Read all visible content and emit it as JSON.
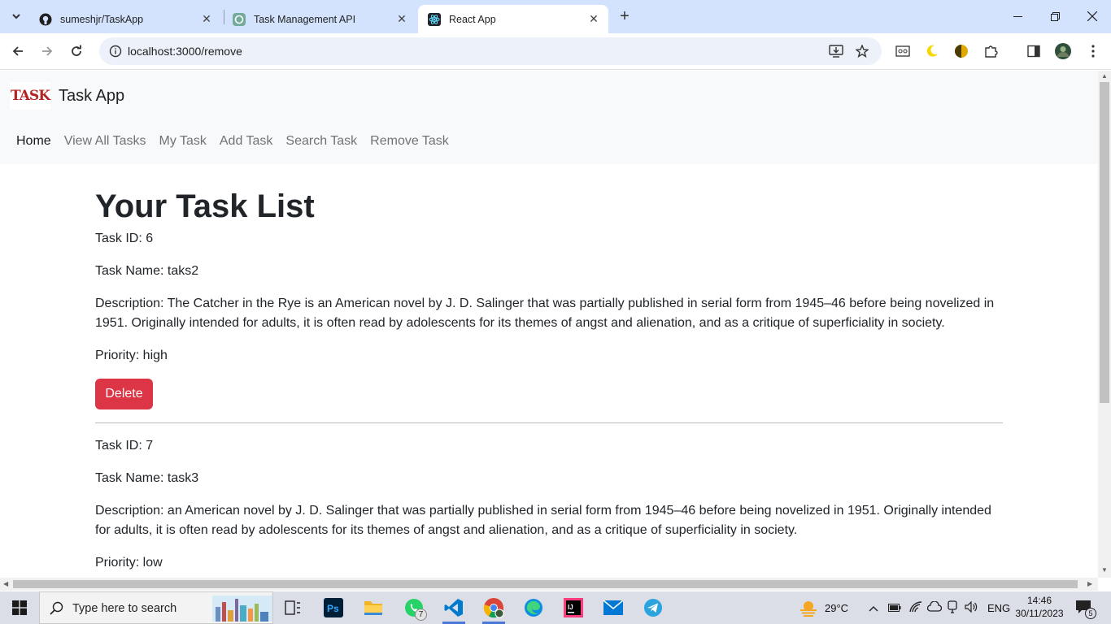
{
  "browser": {
    "tabs": [
      {
        "title": "sumeshjr/TaskApp",
        "icon": "github-icon"
      },
      {
        "title": "Task Management API",
        "icon": "chatgpt-icon"
      },
      {
        "title": "React App",
        "icon": "react-icon",
        "active": true
      }
    ],
    "url": "localhost:3000/remove"
  },
  "navbar": {
    "logo_text": "TASK",
    "brand": "Task App",
    "links": [
      "Home",
      "View All Tasks",
      "My Task",
      "Add Task",
      "Search Task",
      "Remove Task"
    ]
  },
  "page": {
    "heading": "Your Task List",
    "delete_label": "Delete",
    "tasks": [
      {
        "id_line": "Task ID: 6",
        "name_line": "Task Name: taks2",
        "desc_line": "Description: The Catcher in the Rye is an American novel by J. D. Salinger that was partially published in serial form from 1945–46 before being novelized in 1951. Originally intended for adults, it is often read by adolescents for its themes of angst and alienation, and as a critique of superficiality in society.",
        "priority_line": "Priority: high"
      },
      {
        "id_line": "Task ID: 7",
        "name_line": "Task Name: task3",
        "desc_line": "Description: an American novel by J. D. Salinger that was partially published in serial form from 1945–46 before being novelized in 1951. Originally intended for adults, it is often read by adolescents for its themes of angst and alienation, and as a critique of superficiality in society.",
        "priority_line": "Priority: low"
      }
    ]
  },
  "taskbar": {
    "search_placeholder": "Type here to search",
    "whatsapp_badge": "7",
    "weather": "29°C",
    "language": "ENG",
    "time": "14:46",
    "date": "30/11/2023",
    "notifications": "5"
  },
  "colors": {
    "danger": "#dc3545",
    "tabstrip": "#d3e3fd",
    "navbar_bg": "#f8f9fa"
  }
}
